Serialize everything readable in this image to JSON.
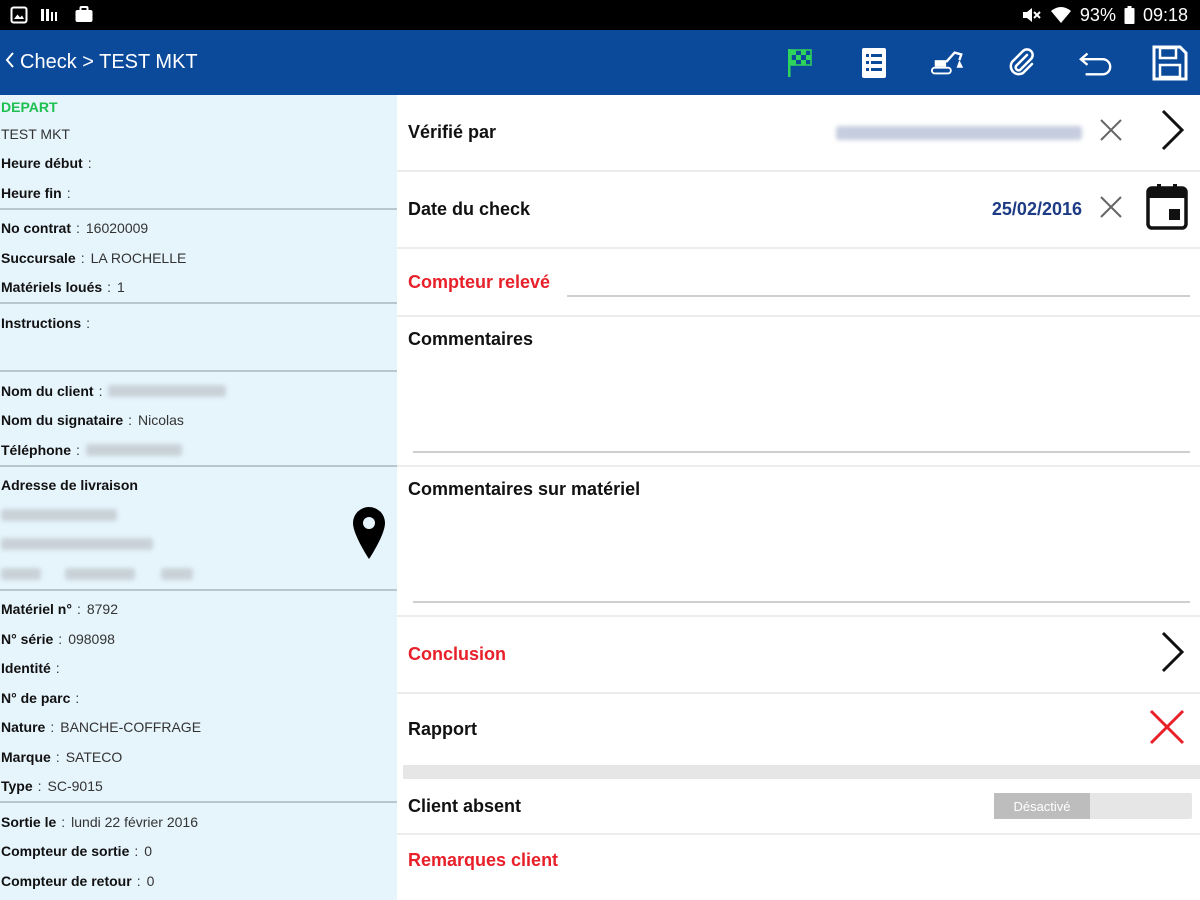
{
  "status_bar": {
    "battery": "93%",
    "time": "09:18"
  },
  "app_bar": {
    "title": "Check > TEST MKT"
  },
  "left_panel": {
    "depart_label": "DEPART",
    "project": "TEST MKT",
    "heure_debut_label": "Heure début",
    "heure_fin_label": "Heure fin",
    "contrat_label": "No contrat",
    "contrat_value": "16020009",
    "succursale_label": "Succursale",
    "succursale_value": "LA ROCHELLE",
    "materiels_loues_label": "Matériels loués",
    "materiels_loues_value": "1",
    "instructions_label": "Instructions",
    "nom_client_label": "Nom du client",
    "nom_signataire_label": "Nom du signataire",
    "nom_signataire_value": "Nicolas",
    "telephone_label": "Téléphone",
    "adresse_label": "Adresse de livraison",
    "materiel_n_label": "Matériel n°",
    "materiel_n_value": "8792",
    "serie_label": "N° série",
    "serie_value": "098098",
    "identite_label": "Identité",
    "parc_label": "N° de parc",
    "nature_label": "Nature",
    "nature_value": "BANCHE-COFFRAGE",
    "marque_label": "Marque",
    "marque_value": "SATECO",
    "type_label": "Type",
    "type_value": "SC-9015",
    "sortie_label": "Sortie le",
    "sortie_value": "lundi 22 février 2016",
    "compteur_sortie_label": "Compteur de sortie",
    "compteur_sortie_value": "0",
    "compteur_retour_label": "Compteur de retour",
    "compteur_retour_value": "0"
  },
  "form": {
    "verifie_par_label": "Vérifié par",
    "date_label": "Date du check",
    "date_value": "25/02/2016",
    "compteur_releve_label": "Compteur relevé",
    "commentaires_label": "Commentaires",
    "commentaires_materiel_label": "Commentaires sur matériel",
    "conclusion_label": "Conclusion",
    "rapport_label": "Rapport",
    "client_absent_label": "Client absent",
    "toggle_text": "Désactivé",
    "remarques_label": "Remarques client"
  },
  "colors": {
    "app_bar": "#0b4a9b",
    "left_panel_bg": "#e6f4fc",
    "accent_red": "#e8202a",
    "accent_green": "#1ec04f",
    "date_blue": "#1c3b84"
  }
}
